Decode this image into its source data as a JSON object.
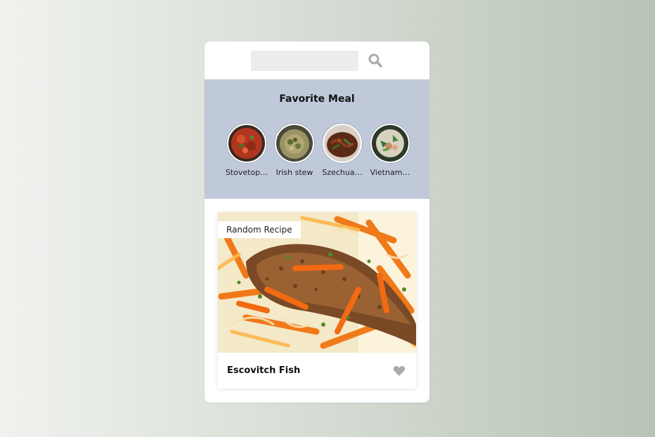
{
  "search": {
    "placeholder": "",
    "value": "",
    "icon": "search-icon"
  },
  "favorites": {
    "title": "Favorite Meal",
    "items": [
      {
        "label": "Stovetop…"
      },
      {
        "label": "Irish stew"
      },
      {
        "label": "Szechua…"
      },
      {
        "label": "Vietnam…"
      }
    ]
  },
  "random": {
    "badge": "Random Recipe",
    "meal_name": "Escovitch Fish",
    "favorite_icon": "heart-icon"
  },
  "colors": {
    "favorites_bg": "#c0c9d9",
    "icon_gray": "#aaaaaa"
  }
}
